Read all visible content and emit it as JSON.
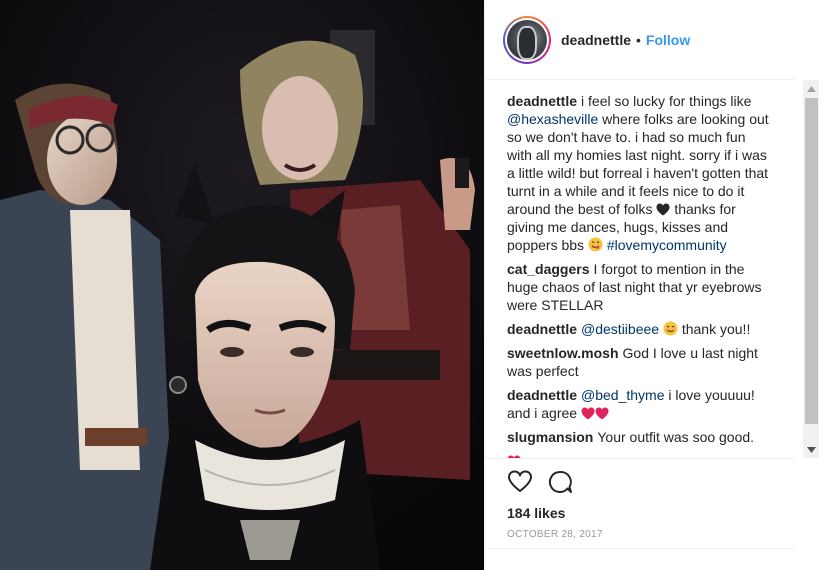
{
  "post": {
    "username": "deadnettle",
    "separator": "•",
    "follow_label": "Follow"
  },
  "comments": [
    {
      "user": "deadnettle",
      "parts": [
        {
          "t": "text",
          "v": "i feel so lucky for things like "
        },
        {
          "t": "mention",
          "v": "@hexasheville"
        },
        {
          "t": "text",
          "v": " where folks are looking out so we don't have to. i had so much fun with all my homies last night. sorry if i was a little wild! but forreal i haven't gotten that turnt in a while and it feels nice to do it around the best of folks "
        },
        {
          "t": "emoji",
          "v": "black-heart"
        },
        {
          "t": "text",
          "v": " thanks for giving me dances, hugs, kisses and poppers bbs "
        },
        {
          "t": "emoji",
          "v": "yum-face"
        },
        {
          "t": "text",
          "v": " "
        },
        {
          "t": "tag",
          "v": "#lovemycommunity"
        }
      ]
    },
    {
      "user": "cat_daggers",
      "parts": [
        {
          "t": "text",
          "v": "I forgot to mention in the huge chaos of last night that yr eyebrows were STELLAR"
        }
      ]
    },
    {
      "user": "deadnettle",
      "parts": [
        {
          "t": "mention",
          "v": "@destiibeee"
        },
        {
          "t": "text",
          "v": " "
        },
        {
          "t": "emoji",
          "v": "smile-face"
        },
        {
          "t": "text",
          "v": " thank you!!"
        }
      ]
    },
    {
      "user": "sweetnlow.mosh",
      "parts": [
        {
          "t": "text",
          "v": "God I love u last night was perfect"
        }
      ]
    },
    {
      "user": "deadnettle",
      "parts": [
        {
          "t": "mention",
          "v": "@bed_thyme"
        },
        {
          "t": "text",
          "v": " i love youuuu! and i agree "
        },
        {
          "t": "emoji",
          "v": "red-heart"
        },
        {
          "t": "emoji",
          "v": "red-heart"
        }
      ]
    },
    {
      "user": "slugmansion",
      "parts": [
        {
          "t": "text",
          "v": "Your outfit was soo good."
        }
      ]
    },
    {
      "user": "",
      "parts": [
        {
          "t": "emoji",
          "v": "red-heart"
        }
      ]
    }
  ],
  "stats": {
    "likes": "184 likes",
    "date": "OCTOBER 28, 2017"
  },
  "icons": {
    "like": "heart-outline-icon",
    "comment": "comment-bubble-icon",
    "scroll_up": "scroll-up-arrow-icon",
    "scroll_down": "scroll-down-arrow-icon"
  },
  "colors": {
    "link": "#003569",
    "follow": "#3897f0",
    "text": "#262626",
    "muted": "#999999",
    "heart_red": "#e0245e"
  }
}
